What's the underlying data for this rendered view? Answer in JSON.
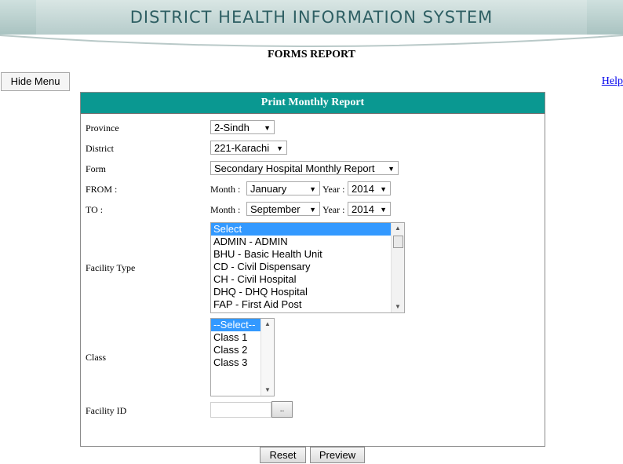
{
  "header": {
    "title": "DISTRICT HEALTH INFORMATION SYSTEM",
    "subtitle": "FORMS REPORT"
  },
  "nav": {
    "hide_menu_label": "Hide Menu",
    "help_label": "Help"
  },
  "panel": {
    "title": "Print Monthly Report",
    "province": {
      "label": "Province",
      "value": "2-Sindh"
    },
    "district": {
      "label": "District",
      "value": "221-Karachi"
    },
    "form": {
      "label": "Form",
      "value": "Secondary Hospital Monthly Report"
    },
    "from": {
      "label": "FROM :",
      "month_label": "Month :",
      "month": "January",
      "year_label": "Year :",
      "year": "2014"
    },
    "to": {
      "label": "TO :",
      "month_label": "Month :",
      "month": "September",
      "year_label": "Year :",
      "year": "2014"
    },
    "facility_type": {
      "label": "Facility Type",
      "options": [
        "Select",
        "ADMIN - ADMIN",
        "BHU - Basic Health Unit",
        "CD - Civil Dispensary",
        "CH - Civil Hospital",
        "DHQ - DHQ Hospital",
        "FAP - First Aid Post"
      ],
      "selected_index": 0
    },
    "class": {
      "label": "Class",
      "options": [
        "--Select--",
        "Class 1",
        "Class 2",
        "Class 3"
      ],
      "selected_index": 0
    },
    "facility_id": {
      "label": "Facility ID",
      "value": "",
      "lookup_label": ".."
    }
  },
  "actions": {
    "reset_label": "Reset",
    "preview_label": "Preview"
  },
  "colors": {
    "panel_header": "#0a9891",
    "banner_text": "#2e5f63",
    "selection": "#3399ff"
  }
}
